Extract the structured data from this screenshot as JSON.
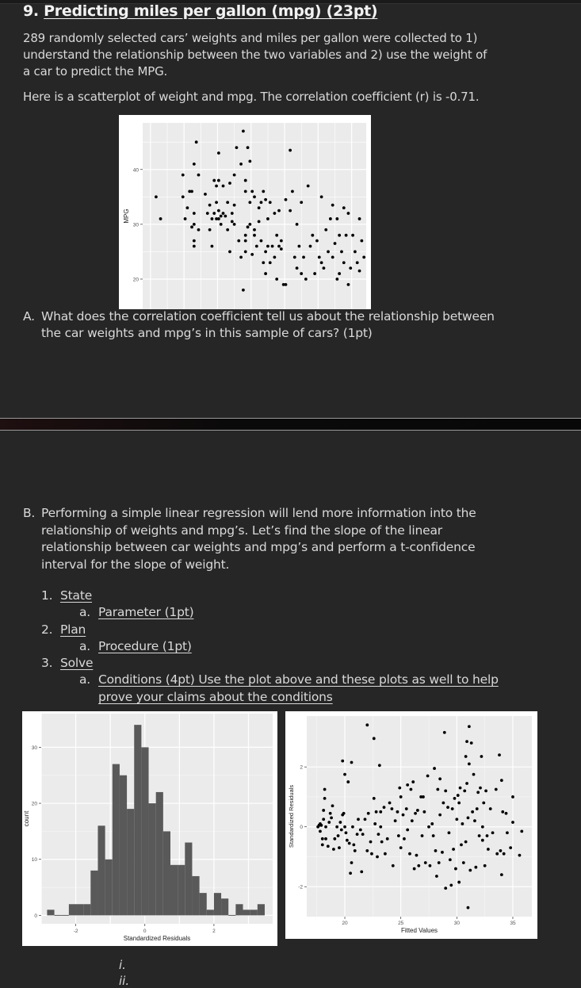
{
  "question": {
    "number": "9.",
    "title": "Predicting miles per gallon (mpg) (23pt)",
    "intro_lines": [
      "289 randomly selected cars’ weights and miles per gallon were collected to 1)",
      "understand the relationship between the two variables and 2) use the weight of",
      "a car to predict the MPG."
    ],
    "scatter_caption": "Here is a scatterplot of weight and mpg. The correlation coefficient (r) is -0.71."
  },
  "part_a": {
    "label": "A.",
    "lines": [
      "What does the correlation coefficient tell us about the relationship between",
      "the car weights and mpg’s in this sample of cars? (1pt)"
    ]
  },
  "part_b": {
    "label": "B.",
    "lines": [
      "Performing a simple linear regression will lend more information into the",
      "relationship of weights and mpg’s.  Let’s find the slope of the linear",
      "relationship between car weights and mpg’s and perform a t-confidence",
      "interval for the slope of weight."
    ],
    "steps": [
      {
        "num": "1.",
        "label": "State",
        "sub": [
          {
            "num": "a.",
            "lines": [
              "Parameter (1pt)"
            ]
          }
        ]
      },
      {
        "num": "2.",
        "label": "Plan",
        "sub": [
          {
            "num": "a.",
            "lines": [
              "Procedure (1pt)"
            ]
          }
        ]
      },
      {
        "num": "3.",
        "label": "Solve",
        "sub": [
          {
            "num": "a.",
            "lines": [
              "Conditions (4pt) Use the plot above and these plots as well to help",
              "prove your claims about the conditions"
            ]
          }
        ]
      }
    ],
    "roman": [
      "i.",
      "ii."
    ]
  },
  "chart_data": [
    {
      "type": "scatter",
      "title": "",
      "xlabel": "",
      "ylabel": "MPG",
      "yticks": [
        20,
        30,
        40
      ],
      "ylim": [
        14.5,
        48.5
      ],
      "xlim": [
        0,
        1
      ],
      "x_note": "weight (axis not visible; relative scale 0-1)",
      "grid": true,
      "points": [
        [
          0.06,
          35
        ],
        [
          0.08,
          31
        ],
        [
          0.18,
          39
        ],
        [
          0.18,
          35
        ],
        [
          0.19,
          31
        ],
        [
          0.2,
          33
        ],
        [
          0.21,
          36
        ],
        [
          0.22,
          36
        ],
        [
          0.23,
          41
        ],
        [
          0.23,
          32
        ],
        [
          0.23,
          27
        ],
        [
          0.23,
          26
        ],
        [
          0.22,
          29.5
        ],
        [
          0.23,
          30
        ],
        [
          0.24,
          45
        ],
        [
          0.25,
          29
        ],
        [
          0.25,
          39
        ],
        [
          0.28,
          35.5
        ],
        [
          0.29,
          32
        ],
        [
          0.3,
          29
        ],
        [
          0.3,
          33.5
        ],
        [
          0.31,
          26
        ],
        [
          0.31,
          31
        ],
        [
          0.32,
          38
        ],
        [
          0.32,
          32
        ],
        [
          0.33,
          31
        ],
        [
          0.33,
          37
        ],
        [
          0.33,
          34
        ],
        [
          0.34,
          31
        ],
        [
          0.34,
          43
        ],
        [
          0.34,
          38
        ],
        [
          0.34,
          32.5
        ],
        [
          0.35,
          30
        ],
        [
          0.35,
          31.5
        ],
        [
          0.36,
          32
        ],
        [
          0.36,
          37
        ],
        [
          0.37,
          31.5
        ],
        [
          0.38,
          29
        ],
        [
          0.38,
          34
        ],
        [
          0.39,
          25
        ],
        [
          0.39,
          37.5
        ],
        [
          0.4,
          30.5
        ],
        [
          0.4,
          32
        ],
        [
          0.41,
          33.5
        ],
        [
          0.41,
          39
        ],
        [
          0.41,
          30
        ],
        [
          0.42,
          44
        ],
        [
          0.43,
          27
        ],
        [
          0.44,
          24
        ],
        [
          0.44,
          41
        ],
        [
          0.45,
          47
        ],
        [
          0.45,
          18
        ],
        [
          0.46,
          38
        ],
        [
          0.46,
          36
        ],
        [
          0.46,
          28
        ],
        [
          0.46,
          25
        ],
        [
          0.46,
          27
        ],
        [
          0.47,
          44
        ],
        [
          0.47,
          29.5
        ],
        [
          0.48,
          41.5
        ],
        [
          0.48,
          34
        ],
        [
          0.48,
          30
        ],
        [
          0.49,
          36
        ],
        [
          0.49,
          24.5
        ],
        [
          0.5,
          28
        ],
        [
          0.5,
          29
        ],
        [
          0.5,
          35
        ],
        [
          0.51,
          26
        ],
        [
          0.52,
          33
        ],
        [
          0.52,
          30.5
        ],
        [
          0.53,
          34
        ],
        [
          0.53,
          27
        ],
        [
          0.54,
          36
        ],
        [
          0.54,
          23
        ],
        [
          0.55,
          25
        ],
        [
          0.55,
          21
        ],
        [
          0.55,
          34.5
        ],
        [
          0.56,
          31
        ],
        [
          0.56,
          26
        ],
        [
          0.57,
          34
        ],
        [
          0.57,
          23
        ],
        [
          0.58,
          26
        ],
        [
          0.59,
          24
        ],
        [
          0.59,
          32
        ],
        [
          0.6,
          28
        ],
        [
          0.6,
          20
        ],
        [
          0.61,
          32.5
        ],
        [
          0.61,
          26
        ],
        [
          0.62,
          27
        ],
        [
          0.62,
          25.5
        ],
        [
          0.63,
          19
        ],
        [
          0.64,
          34.5
        ],
        [
          0.64,
          19
        ],
        [
          0.66,
          43.5
        ],
        [
          0.66,
          32.5
        ],
        [
          0.67,
          36
        ],
        [
          0.68,
          24
        ],
        [
          0.69,
          30
        ],
        [
          0.69,
          22
        ],
        [
          0.7,
          26
        ],
        [
          0.71,
          34
        ],
        [
          0.71,
          21
        ],
        [
          0.72,
          24
        ],
        [
          0.73,
          20
        ],
        [
          0.74,
          37
        ],
        [
          0.75,
          26
        ],
        [
          0.76,
          28
        ],
        [
          0.77,
          21
        ],
        [
          0.78,
          27
        ],
        [
          0.79,
          24
        ],
        [
          0.8,
          35
        ],
        [
          0.8,
          23
        ],
        [
          0.81,
          22
        ],
        [
          0.82,
          29
        ],
        [
          0.83,
          25
        ],
        [
          0.84,
          31
        ],
        [
          0.85,
          33.5
        ],
        [
          0.85,
          24
        ],
        [
          0.86,
          26.5
        ],
        [
          0.87,
          31
        ],
        [
          0.87,
          20
        ],
        [
          0.88,
          28
        ],
        [
          0.88,
          21
        ],
        [
          0.89,
          25
        ],
        [
          0.9,
          33
        ],
        [
          0.9,
          23
        ],
        [
          0.91,
          28
        ],
        [
          0.92,
          32
        ],
        [
          0.92,
          19
        ],
        [
          0.93,
          22
        ],
        [
          0.94,
          28
        ],
        [
          0.95,
          25
        ],
        [
          0.96,
          23
        ],
        [
          0.97,
          31
        ],
        [
          0.97,
          21.5
        ],
        [
          0.98,
          27
        ],
        [
          0.99,
          24
        ]
      ]
    },
    {
      "type": "bar",
      "subtype": "histogram",
      "title": "",
      "xlabel": "Standardized Residuals",
      "ylabel": "count",
      "xticks": [
        -2,
        0,
        2
      ],
      "yticks": [
        0,
        10,
        20,
        30
      ],
      "xlim": [
        -3.0,
        3.7
      ],
      "ylim": [
        -1.5,
        36
      ],
      "grid": true,
      "bin_start": -2.83,
      "bin_width": 0.21,
      "values": [
        1,
        0,
        0,
        2,
        2,
        2,
        8,
        16,
        10,
        27,
        25,
        19,
        34,
        30,
        20,
        22,
        15,
        9,
        9,
        13,
        7,
        4,
        1,
        4,
        3,
        0,
        2,
        1,
        1,
        2
      ]
    },
    {
      "type": "scatter",
      "title": "",
      "xlabel": "Fitted Values",
      "ylabel": "Standardized Residuals",
      "xticks": [
        20,
        25,
        30,
        35
      ],
      "yticks": [
        -2,
        0,
        2
      ],
      "xlim": [
        16.6,
        36.7
      ],
      "ylim": [
        -3.0,
        3.7
      ],
      "grid": true,
      "points": [
        [
          17.6,
          0
        ],
        [
          17.7,
          0.05
        ],
        [
          17.8,
          0.1
        ],
        [
          17.8,
          -0.15
        ],
        [
          17.9,
          0.05
        ],
        [
          18.0,
          -0.4
        ],
        [
          18.0,
          -0.6
        ],
        [
          18.1,
          0.55
        ],
        [
          18.1,
          0.25
        ],
        [
          18.2,
          1.25
        ],
        [
          18.2,
          0.95
        ],
        [
          18.3,
          0
        ],
        [
          18.3,
          -0.4
        ],
        [
          18.5,
          -0.65
        ],
        [
          18.6,
          0.15
        ],
        [
          18.7,
          0.45
        ],
        [
          18.8,
          0.3
        ],
        [
          18.9,
          0.7
        ],
        [
          19.0,
          -0.75
        ],
        [
          19.1,
          -0.4
        ],
        [
          19.3,
          0
        ],
        [
          19.4,
          -0.3
        ],
        [
          19.5,
          -0.7
        ],
        [
          19.6,
          0.15
        ],
        [
          19.7,
          -0.1
        ],
        [
          19.8,
          2.2
        ],
        [
          19.8,
          0.4
        ],
        [
          19.9,
          0.45
        ],
        [
          20.0,
          1.75
        ],
        [
          20.0,
          0
        ],
        [
          20.1,
          -0.2
        ],
        [
          20.2,
          -0.45
        ],
        [
          20.3,
          1.5
        ],
        [
          20.4,
          -0.55
        ],
        [
          20.5,
          -1.55
        ],
        [
          20.6,
          2.15
        ],
        [
          20.6,
          -1.2
        ],
        [
          20.7,
          0
        ],
        [
          20.8,
          -0.6
        ],
        [
          20.9,
          -0.8
        ],
        [
          21.1,
          -0.25
        ],
        [
          21.2,
          0.25
        ],
        [
          21.4,
          -0.1
        ],
        [
          21.5,
          -1.5
        ],
        [
          21.6,
          -0.25
        ],
        [
          21.8,
          0.25
        ],
        [
          22.0,
          3.4
        ],
        [
          22.0,
          -0.8
        ],
        [
          22.1,
          0.45
        ],
        [
          22.3,
          -0.5
        ],
        [
          22.4,
          -0.9
        ],
        [
          22.6,
          2.95
        ],
        [
          22.6,
          0.95
        ],
        [
          22.7,
          0.1
        ],
        [
          22.8,
          0.5
        ],
        [
          22.9,
          -1.0
        ],
        [
          23.0,
          -0.25
        ],
        [
          23.1,
          2.05
        ],
        [
          23.2,
          0.5
        ],
        [
          23.2,
          0
        ],
        [
          23.3,
          -0.5
        ],
        [
          23.5,
          0.65
        ],
        [
          23.6,
          -0.9
        ],
        [
          23.8,
          -0.4
        ],
        [
          24.0,
          0.8
        ],
        [
          24.2,
          0.6
        ],
        [
          24.3,
          -1.3
        ],
        [
          24.5,
          0.2
        ],
        [
          24.7,
          0.5
        ],
        [
          24.8,
          -0.3
        ],
        [
          24.9,
          1.3
        ],
        [
          25.0,
          1.0
        ],
        [
          25.0,
          -0.7
        ],
        [
          25.2,
          0.4
        ],
        [
          25.3,
          -0.4
        ],
        [
          25.5,
          0.6
        ],
        [
          25.6,
          1.4
        ],
        [
          25.6,
          -0.1
        ],
        [
          25.8,
          -0.9
        ],
        [
          25.9,
          1.25
        ],
        [
          26.0,
          0.2
        ],
        [
          26.1,
          1.5
        ],
        [
          26.2,
          -1.4
        ],
        [
          26.3,
          0.45
        ],
        [
          26.4,
          -0.95
        ],
        [
          26.5,
          0.55
        ],
        [
          26.6,
          -1.3
        ],
        [
          26.8,
          1.0
        ],
        [
          26.9,
          -0.3
        ],
        [
          27.0,
          1.0
        ],
        [
          27.1,
          0.5
        ],
        [
          27.2,
          -1.2
        ],
        [
          27.4,
          1.7
        ],
        [
          27.5,
          0
        ],
        [
          27.6,
          -1.3
        ],
        [
          27.8,
          0.1
        ],
        [
          27.9,
          -0.3
        ],
        [
          28.0,
          1.95
        ],
        [
          28.1,
          -0.8
        ],
        [
          28.2,
          -1.65
        ],
        [
          28.3,
          1.25
        ],
        [
          28.4,
          -1.2
        ],
        [
          28.5,
          1.6
        ],
        [
          28.5,
          0.4
        ],
        [
          28.7,
          -0.85
        ],
        [
          28.8,
          0.8
        ],
        [
          28.9,
          3.15
        ],
        [
          29.0,
          1.2
        ],
        [
          29.0,
          -2.05
        ],
        [
          29.2,
          0.65
        ],
        [
          29.3,
          -0.2
        ],
        [
          29.4,
          -1.1
        ],
        [
          29.5,
          -1.95
        ],
        [
          29.6,
          0.6
        ],
        [
          29.7,
          -0.75
        ],
        [
          29.8,
          0.95
        ],
        [
          29.9,
          -1.4
        ],
        [
          30.0,
          0.25
        ],
        [
          30.1,
          1.05
        ],
        [
          30.2,
          -1.85
        ],
        [
          30.2,
          0.8
        ],
        [
          30.3,
          1.3
        ],
        [
          30.4,
          -0.6
        ],
        [
          30.5,
          0.1
        ],
        [
          30.6,
          -1.2
        ],
        [
          30.7,
          1.2
        ],
        [
          30.8,
          2.35
        ],
        [
          30.8,
          -0.5
        ],
        [
          30.9,
          2.85
        ],
        [
          30.9,
          1.45
        ],
        [
          31.0,
          -2.7
        ],
        [
          31.0,
          0.3
        ],
        [
          31.1,
          3.35
        ],
        [
          31.1,
          2.1
        ],
        [
          31.2,
          -1.45
        ],
        [
          31.3,
          2.8
        ],
        [
          31.4,
          0.5
        ],
        [
          31.5,
          1.75
        ],
        [
          31.6,
          0.2
        ],
        [
          31.7,
          -1.35
        ],
        [
          31.8,
          0.6
        ],
        [
          31.9,
          1.15
        ],
        [
          32.0,
          -0.3
        ],
        [
          32.1,
          1.3
        ],
        [
          32.2,
          2.35
        ],
        [
          32.3,
          0
        ],
        [
          32.3,
          -0.45
        ],
        [
          32.4,
          0.8
        ],
        [
          32.5,
          -1.3
        ],
        [
          32.6,
          1.2
        ],
        [
          32.7,
          -0.3
        ],
        [
          32.8,
          -0.75
        ],
        [
          33.0,
          0.6
        ],
        [
          33.2,
          -0.2
        ],
        [
          33.5,
          1.25
        ],
        [
          33.6,
          -0.9
        ],
        [
          33.8,
          2.4
        ],
        [
          33.9,
          -0.8
        ],
        [
          34.0,
          1.55
        ],
        [
          34.0,
          -1.6
        ],
        [
          34.1,
          0.5
        ],
        [
          34.2,
          -0.9
        ],
        [
          34.4,
          0.45
        ],
        [
          34.5,
          -0.2
        ],
        [
          34.8,
          -0.7
        ],
        [
          35.0,
          1.0
        ],
        [
          35.0,
          0.15
        ],
        [
          35.6,
          -0.95
        ],
        [
          35.8,
          -0.15
        ]
      ]
    }
  ]
}
